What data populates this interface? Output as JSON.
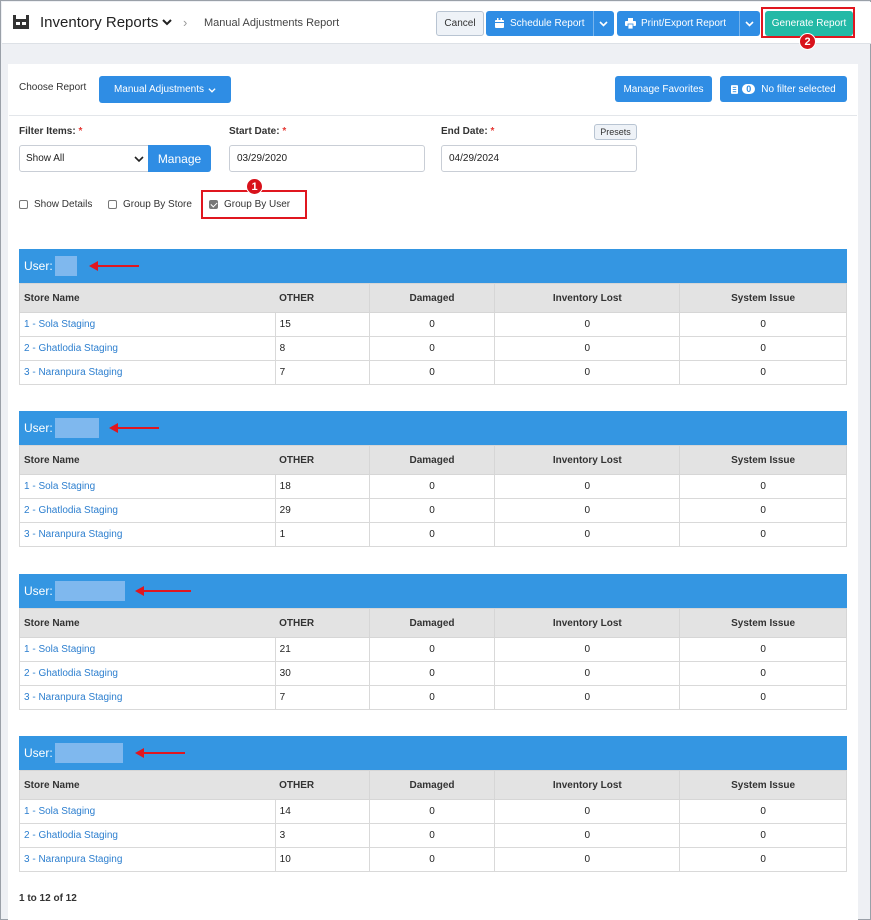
{
  "header": {
    "title": "Inventory Reports",
    "breadcrumb": "Manual Adjustments Report",
    "cancel_label": "Cancel",
    "schedule_label": "Schedule Report",
    "print_label": "Print/Export Report",
    "generate_label": "Generate Report"
  },
  "controls": {
    "choose_report_label": "Choose Report",
    "report_value": "Manual Adjustments",
    "manage_favorites_label": "Manage Favorites",
    "filter_count": "0",
    "filter_label": "No filter selected",
    "filter_items_label": "Filter Items:",
    "filter_items_value": "Show All",
    "manage_label": "Manage",
    "start_date_label": "Start Date:",
    "start_date_value": "03/29/2020",
    "end_date_label": "End Date:",
    "end_date_value": "04/29/2024",
    "presets_label": "Presets",
    "required_mark": "*",
    "show_details_label": "Show Details",
    "group_by_store_label": "Group By Store",
    "group_by_user_label": "Group By User"
  },
  "annotations": {
    "step1": "1",
    "step2": "2"
  },
  "table": {
    "user_prefix": "User:",
    "headers": [
      "Store Name",
      "OTHER",
      "Damaged",
      "Inventory Lost",
      "System Issue"
    ]
  },
  "groups": [
    {
      "rows": [
        [
          "1 - Sola Staging",
          "15",
          "0",
          "0",
          "0"
        ],
        [
          "2 - Ghatlodia Staging",
          "8",
          "0",
          "0",
          "0"
        ],
        [
          "3 - Naranpura Staging",
          "7",
          "0",
          "0",
          "0"
        ]
      ]
    },
    {
      "rows": [
        [
          "1 - Sola Staging",
          "18",
          "0",
          "0",
          "0"
        ],
        [
          "2 - Ghatlodia Staging",
          "29",
          "0",
          "0",
          "0"
        ],
        [
          "3 - Naranpura Staging",
          "1",
          "0",
          "0",
          "0"
        ]
      ]
    },
    {
      "rows": [
        [
          "1 - Sola Staging",
          "21",
          "0",
          "0",
          "0"
        ],
        [
          "2 - Ghatlodia Staging",
          "30",
          "0",
          "0",
          "0"
        ],
        [
          "3 - Naranpura Staging",
          "7",
          "0",
          "0",
          "0"
        ]
      ]
    },
    {
      "rows": [
        [
          "1 - Sola Staging",
          "14",
          "0",
          "0",
          "0"
        ],
        [
          "2 - Ghatlodia Staging",
          "3",
          "0",
          "0",
          "0"
        ],
        [
          "3 - Naranpura Staging",
          "10",
          "0",
          "0",
          "0"
        ]
      ]
    }
  ],
  "pager": "1 to 12 of 12",
  "colors": {
    "primary": "#2f8de4",
    "generate": "#23b9a6",
    "highlight": "#e0161f",
    "group_header": "#3496e2"
  }
}
